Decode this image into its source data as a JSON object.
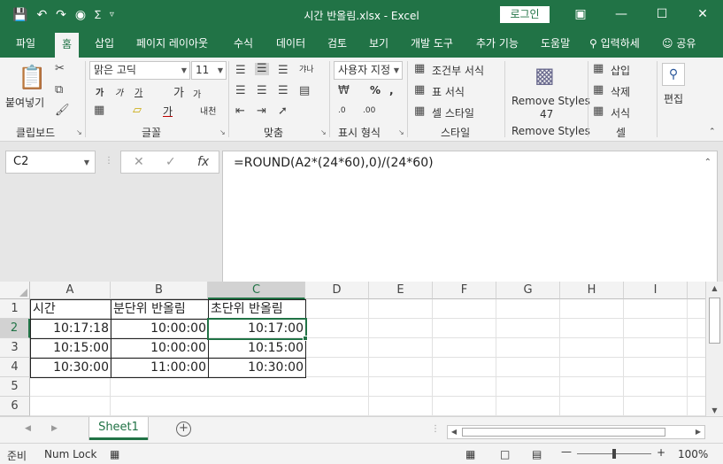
{
  "titlebar": {
    "title": "시간 반올림.xlsx  -  Excel",
    "login_label": "로그인",
    "icons": [
      "save-icon",
      "undo-icon",
      "redo-icon",
      "camera-icon",
      "format-symbol-icon",
      "customize-qat-icon"
    ]
  },
  "tabs": [
    "파일",
    "홈",
    "삽입",
    "페이지 레이아웃",
    "수식",
    "데이터",
    "검토",
    "보기",
    "개발 도구",
    "추가 기능",
    "도움말",
    "입력하세",
    "공유"
  ],
  "ribbon": {
    "clipboard": {
      "paste_label": "붙여넣기",
      "group_label": "클립보드"
    },
    "font": {
      "name": "맑은 고딕",
      "size": "11",
      "group_label": "글꼴",
      "bold": "가",
      "italic": "가",
      "underline": "가",
      "grow": "가",
      "shrink": "가",
      "fontcolor": "가",
      "phonetic": "내천"
    },
    "alignment": {
      "group_label": "맞춤",
      "wrap": "갸나"
    },
    "number": {
      "format": "사용자 지정",
      "group_label": "표시 형식"
    },
    "styles": {
      "conditional": "조건부 서식",
      "table": "표 서식",
      "cell": "셀 스타일",
      "group_label": "스타일"
    },
    "remove_styles": {
      "label": "Remove Styles",
      "count": "47",
      "group_label": "Remove Styles"
    },
    "cells": {
      "insert": "삽입",
      "delete": "삭제",
      "format": "서식",
      "group_label": "셀"
    },
    "editing": {
      "label": "편집"
    }
  },
  "formula_bar": {
    "name_box": "C2",
    "formula": "=ROUND(A2*(24*60),0)/(24*60)"
  },
  "grid": {
    "columns": [
      "A",
      "B",
      "C",
      "D",
      "E",
      "F",
      "G",
      "H",
      "I"
    ],
    "rows": [
      "1",
      "2",
      "3",
      "4",
      "5",
      "6"
    ],
    "cells": [
      [
        "시간",
        "분단위 반올림",
        "초단위 반올림"
      ],
      [
        "10:17:18",
        "10:00:00",
        "10:17:00"
      ],
      [
        "10:15:00",
        "10:00:00",
        "10:15:00"
      ],
      [
        "10:30:00",
        "11:00:00",
        "10:30:00"
      ]
    ]
  },
  "sheets": {
    "active": "Sheet1"
  },
  "status": {
    "mode": "준비",
    "numlock": "Num Lock",
    "zoom": "100%"
  }
}
